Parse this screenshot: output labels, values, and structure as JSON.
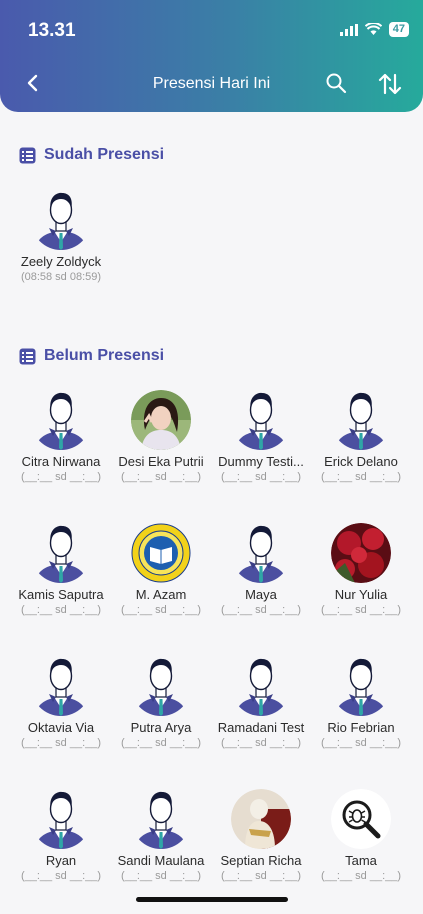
{
  "status": {
    "time": "13.31",
    "battery": "47"
  },
  "header": {
    "title": "Presensi Hari Ini"
  },
  "sudah": {
    "title": "Sudah Presensi",
    "people": [
      {
        "name": "Zeely Zoldyck",
        "time": "(08:58 sd 08:59)",
        "avatar": "default-avatar"
      }
    ]
  },
  "belum": {
    "title": "Belum Presensi",
    "people": [
      {
        "name": "Citra Nirwana",
        "time": "(__:__ sd __:__)",
        "avatar": "default-avatar"
      },
      {
        "name": "Desi Eka Putrii",
        "time": "(__:__ sd __:__)",
        "avatar": "photo-woman"
      },
      {
        "name": "Dummy Testi...",
        "time": "(__:__ sd __:__)",
        "avatar": "default-avatar"
      },
      {
        "name": "Erick Delano",
        "time": "(__:__ sd __:__)",
        "avatar": "default-avatar"
      },
      {
        "name": "Kamis Saputra",
        "time": "(__:__ sd __:__)",
        "avatar": "default-avatar"
      },
      {
        "name": "M. Azam",
        "time": "(__:__ sd __:__)",
        "avatar": "book-emblem"
      },
      {
        "name": "Maya",
        "time": "(__:__ sd __:__)",
        "avatar": "default-avatar"
      },
      {
        "name": "Nur Yulia",
        "time": "(__:__ sd __:__)",
        "avatar": "photo-roses"
      },
      {
        "name": "Oktavia Via",
        "time": "(__:__ sd __:__)",
        "avatar": "default-avatar"
      },
      {
        "name": "Putra Arya",
        "time": "(__:__ sd __:__)",
        "avatar": "default-avatar"
      },
      {
        "name": "Ramadani Test",
        "time": "(__:__ sd __:__)",
        "avatar": "default-avatar"
      },
      {
        "name": "Rio Febrian",
        "time": "(__:__ sd __:__)",
        "avatar": "default-avatar"
      },
      {
        "name": "Ryan",
        "time": "(__:__ sd __:__)",
        "avatar": "default-avatar"
      },
      {
        "name": "Sandi Maulana",
        "time": "(__:__ sd __:__)",
        "avatar": "default-avatar"
      },
      {
        "name": "Septian Richa",
        "time": "(__:__ sd __:__)",
        "avatar": "photo-figure"
      },
      {
        "name": "Tama",
        "time": "(__:__ sd __:__)",
        "avatar": "bug-search-icon"
      }
    ]
  },
  "colors": {
    "accent": "#4a4fa6",
    "gradient_start": "#4a5aad",
    "gradient_end": "#26aa9c"
  }
}
